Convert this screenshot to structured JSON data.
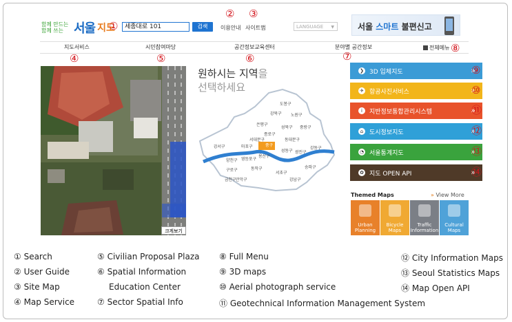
{
  "header": {
    "logo_slogan": "함께 만드는 함께 쓰는",
    "logo_seoul": "서울",
    "logo_jido": "지도",
    "search_value": "세종대로 101",
    "search_button": "검색",
    "user_guide": "이용안내",
    "site_map": "사이트맵",
    "language": "LANGUAGE",
    "banner_prefix": "서울 ",
    "banner_accent": "스마트",
    "banner_suffix": " 불편신고"
  },
  "nav": {
    "items": [
      "지도서비스",
      "시민참여마당",
      "공간정보교육센터",
      "분야별 공간정보"
    ],
    "full_menu": "전체메뉴"
  },
  "aerial": {
    "enlarge_button": "크게보기"
  },
  "map": {
    "title_line1_a": "원하시는 지역",
    "title_line1_b": "을",
    "title_line2": "선택하세요",
    "districts": [
      "도봉구",
      "강북구",
      "노원구",
      "성북구",
      "중랑구",
      "은평구",
      "종로구",
      "동대문구",
      "서대문구",
      "중구",
      "성동구",
      "광진구",
      "강서구",
      "마포구",
      "용산구",
      "양천구",
      "영등포구",
      "동작구",
      "강동구",
      "구로구",
      "관악구",
      "서초구",
      "강남구",
      "송파구",
      "금천구"
    ],
    "highlight_color": "#f39b1e"
  },
  "services": [
    {
      "label": "3D 입체지도",
      "color": "#3b9bd6",
      "icon": "3d-icon"
    },
    {
      "label": "항공사진서비스",
      "color": "#f2b51a",
      "icon": "plane-icon"
    },
    {
      "label": "지반정보통합관리시스템",
      "color": "#e8532b",
      "icon": "info-icon"
    },
    {
      "label": "도시정보지도",
      "color": "#2fa0d8",
      "icon": "house-icon"
    },
    {
      "label": "서울통계지도",
      "color": "#3aa33d",
      "icon": "pie-icon"
    },
    {
      "label": "지도 OPEN API",
      "color": "#4f3a28",
      "icon": "api-icon"
    }
  ],
  "themed": {
    "title": "Themed Maps",
    "view_more": "View More",
    "items": [
      {
        "line1": "Urban",
        "line2": "Planning",
        "color": "#e8812a"
      },
      {
        "line1": "Bicycle",
        "line2": "Maps",
        "color": "#f0a933"
      },
      {
        "line1": "Traffic",
        "line2": "Information",
        "color": "#7b7f86"
      },
      {
        "line1": "Cultural",
        "line2": "Maps",
        "color": "#4fa2d8"
      }
    ]
  },
  "callouts": [
    "①",
    "②",
    "③",
    "④",
    "⑤",
    "⑥",
    "⑦",
    "⑧",
    "⑨",
    "⑩",
    "⑪",
    "⑫",
    "⑬",
    "⑭"
  ],
  "legend": [
    "① Search",
    "② User Guide",
    "③ Site Map",
    "④ Map Service",
    "⑤ Civilian Proposal Plaza",
    "⑥ Spatial Information",
    "Education Center",
    "⑦ Sector Spatial Info",
    "⑧ Full Menu",
    "⑨ 3D maps",
    "⑩ Aerial photograph service",
    "⑪ Geotechnical Information Management System",
    "⑫ City Information Maps",
    "⑬ Seoul Statistics Maps",
    "⑭ Map Open API"
  ]
}
